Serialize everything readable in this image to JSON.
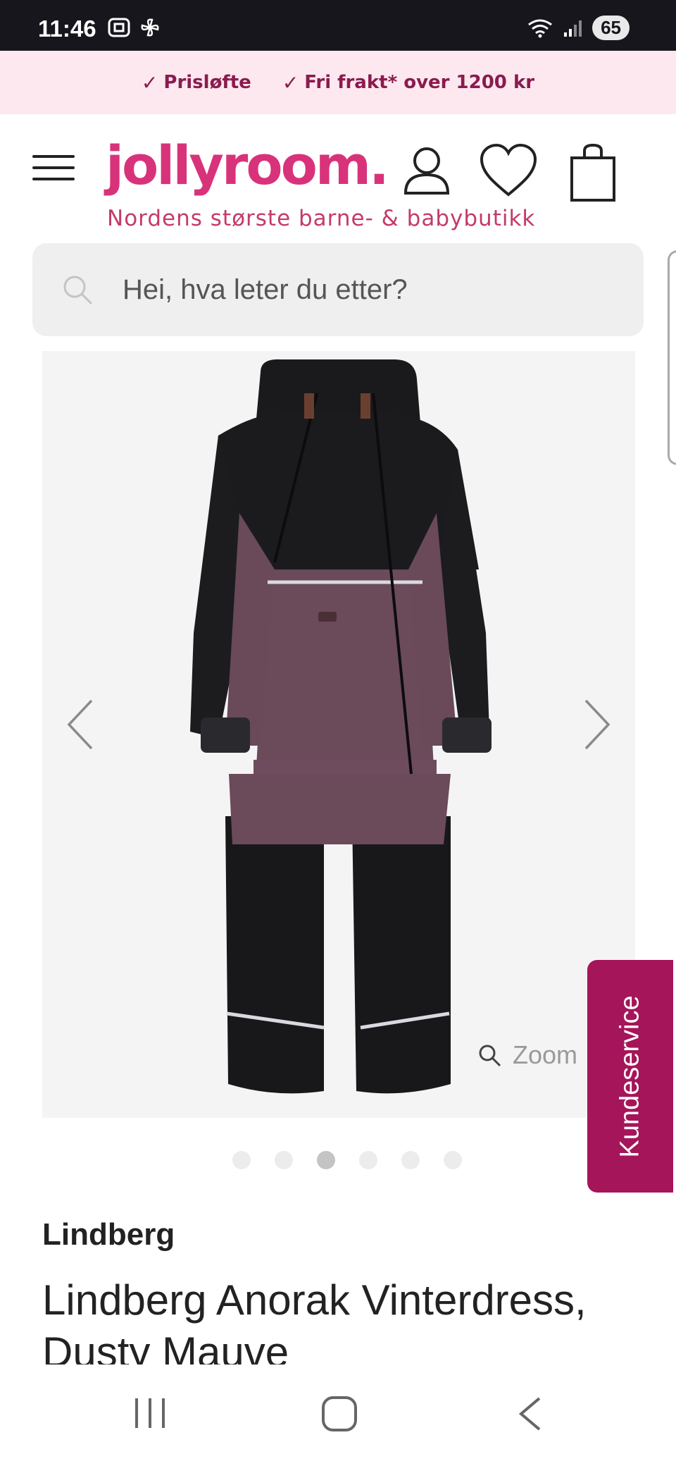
{
  "status_bar": {
    "time": "11:46",
    "battery": "65"
  },
  "promo": {
    "items": [
      "Prisløfte",
      "Fri frakt* over 1200 kr"
    ],
    "check_icon": "✓",
    "color": "#8a1b4f"
  },
  "header": {
    "logo": "jollyroom.",
    "tagline": "Nordens største barne- & babybutikk",
    "brand_color": "#d8337a"
  },
  "search": {
    "placeholder": "Hei, hva leter du etter?"
  },
  "gallery": {
    "zoom_label": "Zoom",
    "dot_count": 6,
    "active_dot": 3
  },
  "side_tab": {
    "label": "Kundeservice",
    "color": "#a5155a"
  },
  "product": {
    "brand": "Lindberg",
    "title": "Lindberg Anorak Vinterdress, Dusty Mauve"
  },
  "icons": {
    "menu": "hamburger-icon",
    "account": "user-icon",
    "wishlist": "heart-icon",
    "cart": "shopping-bag-icon",
    "search": "search-icon",
    "prev": "chevron-left-icon",
    "next": "chevron-right-icon"
  }
}
